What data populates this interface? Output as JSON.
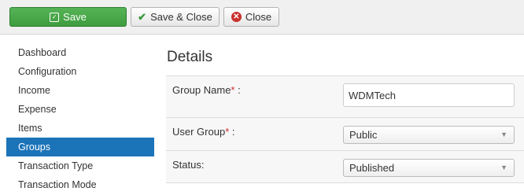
{
  "toolbar": {
    "save_label": "Save",
    "save_close_label": "Save & Close",
    "close_label": "Close"
  },
  "sidebar": {
    "items": [
      {
        "label": "Dashboard"
      },
      {
        "label": "Configuration"
      },
      {
        "label": "Income"
      },
      {
        "label": "Expense"
      },
      {
        "label": "Items"
      },
      {
        "label": "Groups",
        "active": true
      },
      {
        "label": "Transaction Type"
      },
      {
        "label": "Transaction Mode"
      }
    ]
  },
  "details": {
    "title": "Details",
    "group_name_label": "Group Name",
    "group_name_value": "WDMTech",
    "user_group_label": "User Group",
    "user_group_value": "Public",
    "status_label": "Status",
    "status_value": "Published",
    "required_mark": "*",
    "label_suffix": " :",
    "status_label_suffix": ":"
  },
  "colors": {
    "save_button": "#46a546",
    "active_sidebar": "#1b73b8",
    "required": "#c9302c"
  },
  "icons": {
    "save": "save-icon",
    "save_close": "check-icon",
    "close": "close-circle-icon",
    "select_caret": "caret-down-icon"
  }
}
